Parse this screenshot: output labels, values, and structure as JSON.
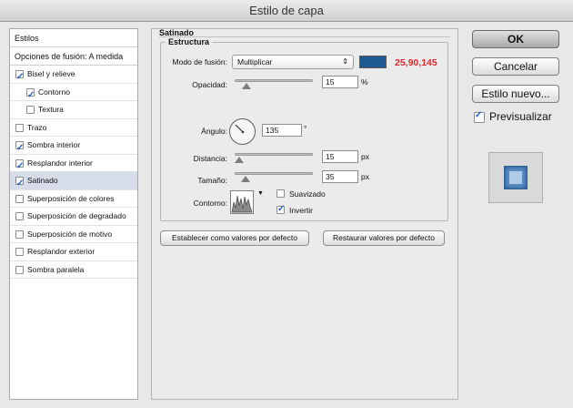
{
  "window": {
    "title": "Estilo de capa"
  },
  "colors": {
    "swatch": "#1d5a91",
    "rgb_text": "#e0282c"
  },
  "sidebar": {
    "header": "Estilos",
    "blend_options": "Opciones de fusión: A medida",
    "items": [
      {
        "label": "Bisel y relieve",
        "checked": true,
        "indent": 0
      },
      {
        "label": "Contorno",
        "checked": true,
        "indent": 1
      },
      {
        "label": "Textura",
        "checked": false,
        "indent": 1
      },
      {
        "label": "Trazo",
        "checked": false,
        "indent": 0
      },
      {
        "label": "Sombra interior",
        "checked": true,
        "indent": 0
      },
      {
        "label": "Resplandor interior",
        "checked": true,
        "indent": 0
      },
      {
        "label": "Satinado",
        "checked": true,
        "indent": 0,
        "selected": true
      },
      {
        "label": "Superposición de colores",
        "checked": false,
        "indent": 0
      },
      {
        "label": "Superposición de degradado",
        "checked": false,
        "indent": 0
      },
      {
        "label": "Superposición de motivo",
        "checked": false,
        "indent": 0
      },
      {
        "label": "Resplandor exterior",
        "checked": false,
        "indent": 0
      },
      {
        "label": "Sombra paralela",
        "checked": false,
        "indent": 0
      }
    ]
  },
  "satin": {
    "section_title": "Satinado",
    "group_title": "Estructura",
    "blend_mode_label": "Modo de fusión:",
    "blend_mode_value": "Multiplicar",
    "rgb_readout": "25,90,145",
    "opacity_label": "Opacidad:",
    "opacity_value": "15",
    "opacity_unit": "%",
    "opacity_level": 0.15,
    "angle_label": "Ángulo:",
    "angle_value": "135",
    "angle_unit": "°",
    "distance_label": "Distancia:",
    "distance_value": "15",
    "distance_unit": "px",
    "distance_level": 0.06,
    "size_label": "Tamaño:",
    "size_value": "35",
    "size_unit": "px",
    "size_level": 0.14,
    "contour_label": "Contorno:",
    "antialias_label": "Suavizado",
    "antialias_checked": false,
    "invert_label": "Invertir",
    "invert_checked": true,
    "make_default_label": "Establecer como valores por defecto",
    "reset_default_label": "Restaurar valores por defecto"
  },
  "actions": {
    "ok_label": "OK",
    "cancel_label": "Cancelar",
    "new_style_label": "Estilo nuevo...",
    "preview_label": "Previsualizar",
    "preview_checked": true
  }
}
